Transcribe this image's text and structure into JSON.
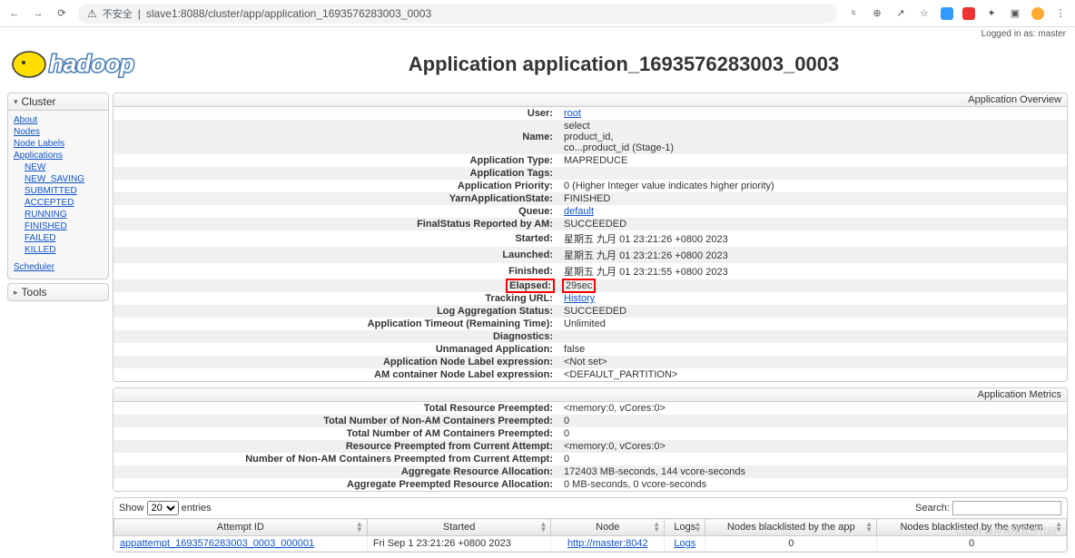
{
  "browser": {
    "insecure": "不安全",
    "url": "slave1:8088/cluster/app/application_1693576283003_0003"
  },
  "logged_in": "Logged in as: master",
  "title": "Application application_1693576283003_0003",
  "sidebar": {
    "cluster": {
      "header": "Cluster",
      "links": [
        "About",
        "Nodes",
        "Node Labels",
        "Applications"
      ],
      "sub": [
        "NEW",
        "NEW_SAVING",
        "SUBMITTED",
        "ACCEPTED",
        "RUNNING",
        "FINISHED",
        "FAILED",
        "KILLED"
      ],
      "scheduler": "Scheduler"
    },
    "tools": {
      "header": "Tools"
    }
  },
  "overview": {
    "heading": "Application Overview",
    "rows": [
      {
        "k": "User:",
        "v": "root",
        "link": true
      },
      {
        "k": "Name:",
        "v": "select\nproduct_id,\nco...product_id (Stage-1)"
      },
      {
        "k": "Application Type:",
        "v": "MAPREDUCE"
      },
      {
        "k": "Application Tags:",
        "v": ""
      },
      {
        "k": "Application Priority:",
        "v": "0 (Higher Integer value indicates higher priority)"
      },
      {
        "k": "YarnApplicationState:",
        "v": "FINISHED"
      },
      {
        "k": "Queue:",
        "v": "default",
        "link": true
      },
      {
        "k": "FinalStatus Reported by AM:",
        "v": "SUCCEEDED"
      },
      {
        "k": "Started:",
        "v": "星期五 九月 01 23:21:26 +0800 2023"
      },
      {
        "k": "Launched:",
        "v": "星期五 九月 01 23:21:26 +0800 2023"
      },
      {
        "k": "Finished:",
        "v": "星期五 九月 01 23:21:55 +0800 2023"
      },
      {
        "k": "Elapsed:",
        "v": "29sec",
        "hl": true
      },
      {
        "k": "Tracking URL:",
        "v": "History",
        "link": true
      },
      {
        "k": "Log Aggregation Status:",
        "v": "SUCCEEDED"
      },
      {
        "k": "Application Timeout (Remaining Time):",
        "v": "Unlimited"
      },
      {
        "k": "Diagnostics:",
        "v": ""
      },
      {
        "k": "Unmanaged Application:",
        "v": "false"
      },
      {
        "k": "Application Node Label expression:",
        "v": "<Not set>"
      },
      {
        "k": "AM container Node Label expression:",
        "v": "<DEFAULT_PARTITION>"
      }
    ]
  },
  "metrics": {
    "heading": "Application Metrics",
    "rows": [
      {
        "k": "Total Resource Preempted:",
        "v": "<memory:0, vCores:0>"
      },
      {
        "k": "Total Number of Non-AM Containers Preempted:",
        "v": "0"
      },
      {
        "k": "Total Number of AM Containers Preempted:",
        "v": "0"
      },
      {
        "k": "Resource Preempted from Current Attempt:",
        "v": "<memory:0, vCores:0>"
      },
      {
        "k": "Number of Non-AM Containers Preempted from Current Attempt:",
        "v": "0"
      },
      {
        "k": "Aggregate Resource Allocation:",
        "v": "172403 MB-seconds, 144 vcore-seconds"
      },
      {
        "k": "Aggregate Preempted Resource Allocation:",
        "v": "0 MB-seconds, 0 vcore-seconds"
      }
    ]
  },
  "attempts": {
    "show_label": "Show",
    "entries_label": "entries",
    "page_size": "20",
    "search_label": "Search:",
    "cols": [
      "Attempt ID",
      "Started",
      "Node",
      "Logs",
      "Nodes blacklisted by the app",
      "Nodes blacklisted by the system"
    ],
    "row": {
      "id": "appattempt_1693576283003_0003_000001",
      "started": "Fri Sep 1 23:21:26 +0800 2023",
      "node": "http://master:8042",
      "logs": "Logs",
      "bl_app": "0",
      "bl_sys": "0"
    }
  },
  "watermark": "CSDN @月亮给我抄代码"
}
